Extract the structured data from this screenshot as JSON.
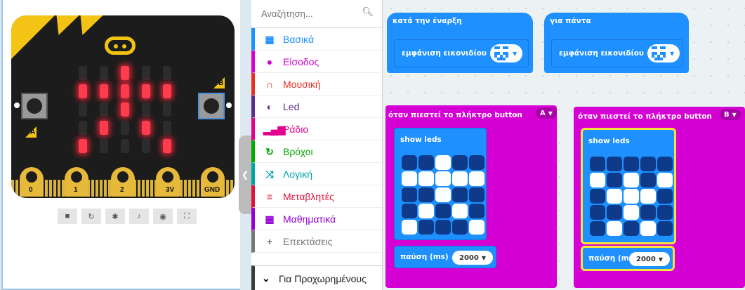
{
  "simulator": {
    "button_a_label": "A",
    "button_b_label": "B",
    "pins": [
      "0",
      "1",
      "2",
      "3V",
      "GND"
    ],
    "led_matrix": [
      [
        0,
        0,
        1,
        0,
        0
      ],
      [
        1,
        1,
        1,
        1,
        1
      ],
      [
        0,
        0,
        1,
        0,
        0
      ],
      [
        0,
        1,
        0,
        1,
        0
      ],
      [
        1,
        0,
        0,
        0,
        1
      ]
    ],
    "controls": [
      {
        "name": "stop-button",
        "icon": "■"
      },
      {
        "name": "restart-button",
        "icon": "↻"
      },
      {
        "name": "debug-button",
        "icon": "✱"
      },
      {
        "name": "mute-button",
        "icon": "♪"
      },
      {
        "name": "screenshot-button",
        "icon": "◉"
      },
      {
        "name": "fullscreen-button",
        "icon": "⛶"
      }
    ]
  },
  "toolbox": {
    "search_placeholder": "Αναζήτηση...",
    "categories": [
      {
        "label": "Βασικά",
        "color": "#1e90ff",
        "icon": "▦",
        "name": "basic"
      },
      {
        "label": "Είσοδος",
        "color": "#d400d4",
        "icon": "●",
        "name": "input"
      },
      {
        "label": "Μουσική",
        "color": "#e63022",
        "icon": "∩",
        "name": "music"
      },
      {
        "label": "Led",
        "color": "#5c2d91",
        "icon": "◐",
        "name": "led"
      },
      {
        "label": "Ράδιο",
        "color": "#e3008c",
        "icon": "▂▄▆",
        "name": "radio"
      },
      {
        "label": "Βρόχοι",
        "color": "#00aa00",
        "icon": "↻",
        "name": "loops"
      },
      {
        "label": "Λογική",
        "color": "#00a4a6",
        "icon": "⤨",
        "name": "logic"
      },
      {
        "label": "Μεταβλητές",
        "color": "#dc143c",
        "icon": "≡",
        "name": "variables"
      },
      {
        "label": "Μαθηματικά",
        "color": "#9400d3",
        "icon": "▦",
        "name": "math"
      },
      {
        "label": "Επεκτάσεις",
        "color": "#777777",
        "icon": "+",
        "name": "extensions"
      }
    ],
    "advanced_label": "Για Προχωρημένους"
  },
  "workspace": {
    "on_start": {
      "title": "κατά την έναρξη",
      "inner": "εμφάνιση εικονιδίου",
      "icon": [
        [
          0,
          0,
          1,
          0,
          0
        ],
        [
          1,
          1,
          1,
          1,
          1
        ],
        [
          0,
          0,
          1,
          0,
          0
        ],
        [
          0,
          1,
          0,
          1,
          0
        ],
        [
          1,
          0,
          0,
          0,
          1
        ]
      ]
    },
    "forever": {
      "title": "για πάντα",
      "inner": "εμφάνιση εικονιδίου",
      "icon": [
        [
          0,
          0,
          1,
          0,
          0
        ],
        [
          1,
          1,
          1,
          1,
          1
        ],
        [
          0,
          0,
          1,
          0,
          0
        ],
        [
          0,
          1,
          0,
          1,
          0
        ],
        [
          1,
          0,
          0,
          0,
          1
        ]
      ]
    },
    "button_a": {
      "title": "όταν πιεστεί το πλήκτρο button",
      "key": "A",
      "show_leds": "show leds",
      "leds": [
        [
          0,
          0,
          1,
          0,
          0
        ],
        [
          1,
          1,
          1,
          1,
          1
        ],
        [
          0,
          0,
          1,
          0,
          0
        ],
        [
          0,
          1,
          0,
          1,
          0
        ],
        [
          1,
          0,
          0,
          0,
          1
        ]
      ],
      "pause_label": "παύση (ms)",
      "pause_value": "2000"
    },
    "button_b": {
      "title": "όταν πιεστεί το πλήκτρο button",
      "key": "B",
      "show_leds": "show leds",
      "leds": [
        [
          0,
          0,
          0,
          0,
          0
        ],
        [
          1,
          0,
          1,
          0,
          1
        ],
        [
          0,
          1,
          1,
          1,
          0
        ],
        [
          0,
          0,
          1,
          0,
          0
        ],
        [
          0,
          1,
          0,
          1,
          0
        ]
      ],
      "pause_label": "παύση (ms)",
      "pause_value": "2000"
    }
  }
}
